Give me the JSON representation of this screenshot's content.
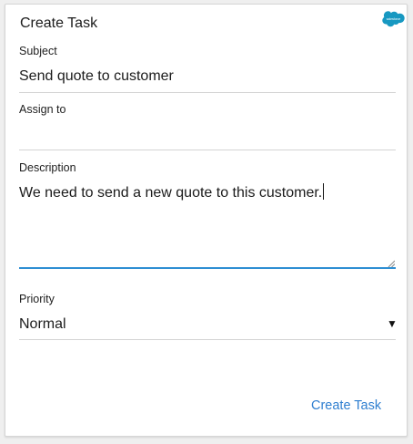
{
  "dialog": {
    "title": "Create Task",
    "logo_text": "salesforce",
    "brand_color": "#1798c1",
    "accent_color": "#2e8fd3"
  },
  "fields": {
    "subject": {
      "label": "Subject",
      "value": "Send quote to customer"
    },
    "assign_to": {
      "label": "Assign to",
      "value": ""
    },
    "description": {
      "label": "Description",
      "value": "We need to send a new quote to this customer."
    },
    "priority": {
      "label": "Priority",
      "value": "Normal",
      "icon": "dropdown-triangle-icon"
    }
  },
  "actions": {
    "create_label": "Create Task"
  }
}
